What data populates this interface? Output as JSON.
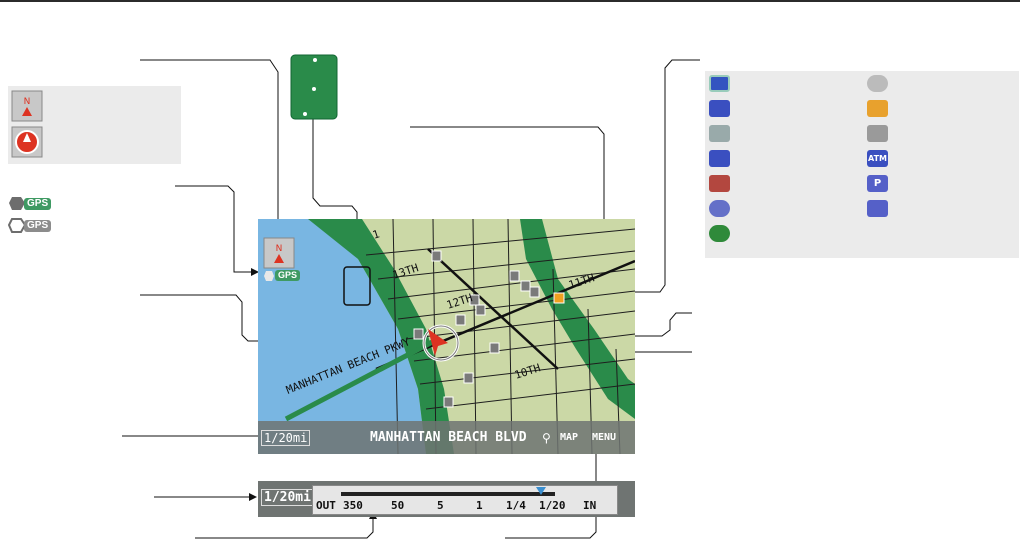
{
  "map": {
    "streets": [
      "13TH",
      "12TH",
      "11TH",
      "10TH",
      "1"
    ],
    "beach_street": "MANHATTAN BEACH PKWY",
    "current_street": "MANHATTAN BEACH BLVD",
    "scale_badge": "1/20mi",
    "map_button": "MAP",
    "menu_button": "MENU"
  },
  "gps_labels": [
    "GPS",
    "GPS",
    "GPS"
  ],
  "scale_bar": {
    "badge": "1/20mi",
    "out_label": "OUT",
    "in_label": "IN",
    "ticks": [
      "350",
      "50",
      "5",
      "1",
      "1/4",
      "1/20"
    ]
  },
  "legend_icons": [
    "honda-dealer-icon",
    "acura-dealer-icon",
    "hospital-icon",
    "music-icon",
    "shopping-icon",
    "restaurant-icon",
    "gas-station-icon",
    "atm-icon",
    "lodging-icon",
    "parking-icon",
    "parking-garage-icon",
    "train-station-icon",
    "info-icon"
  ],
  "legend_text": {
    "atm": "ATM",
    "parking": "P"
  },
  "colors": {
    "water": "#79b6e2",
    "land": "#cbd8a6",
    "park": "#2a8b4a",
    "gps_chip": "#3f9a63",
    "atm": "#3a4fc0"
  }
}
